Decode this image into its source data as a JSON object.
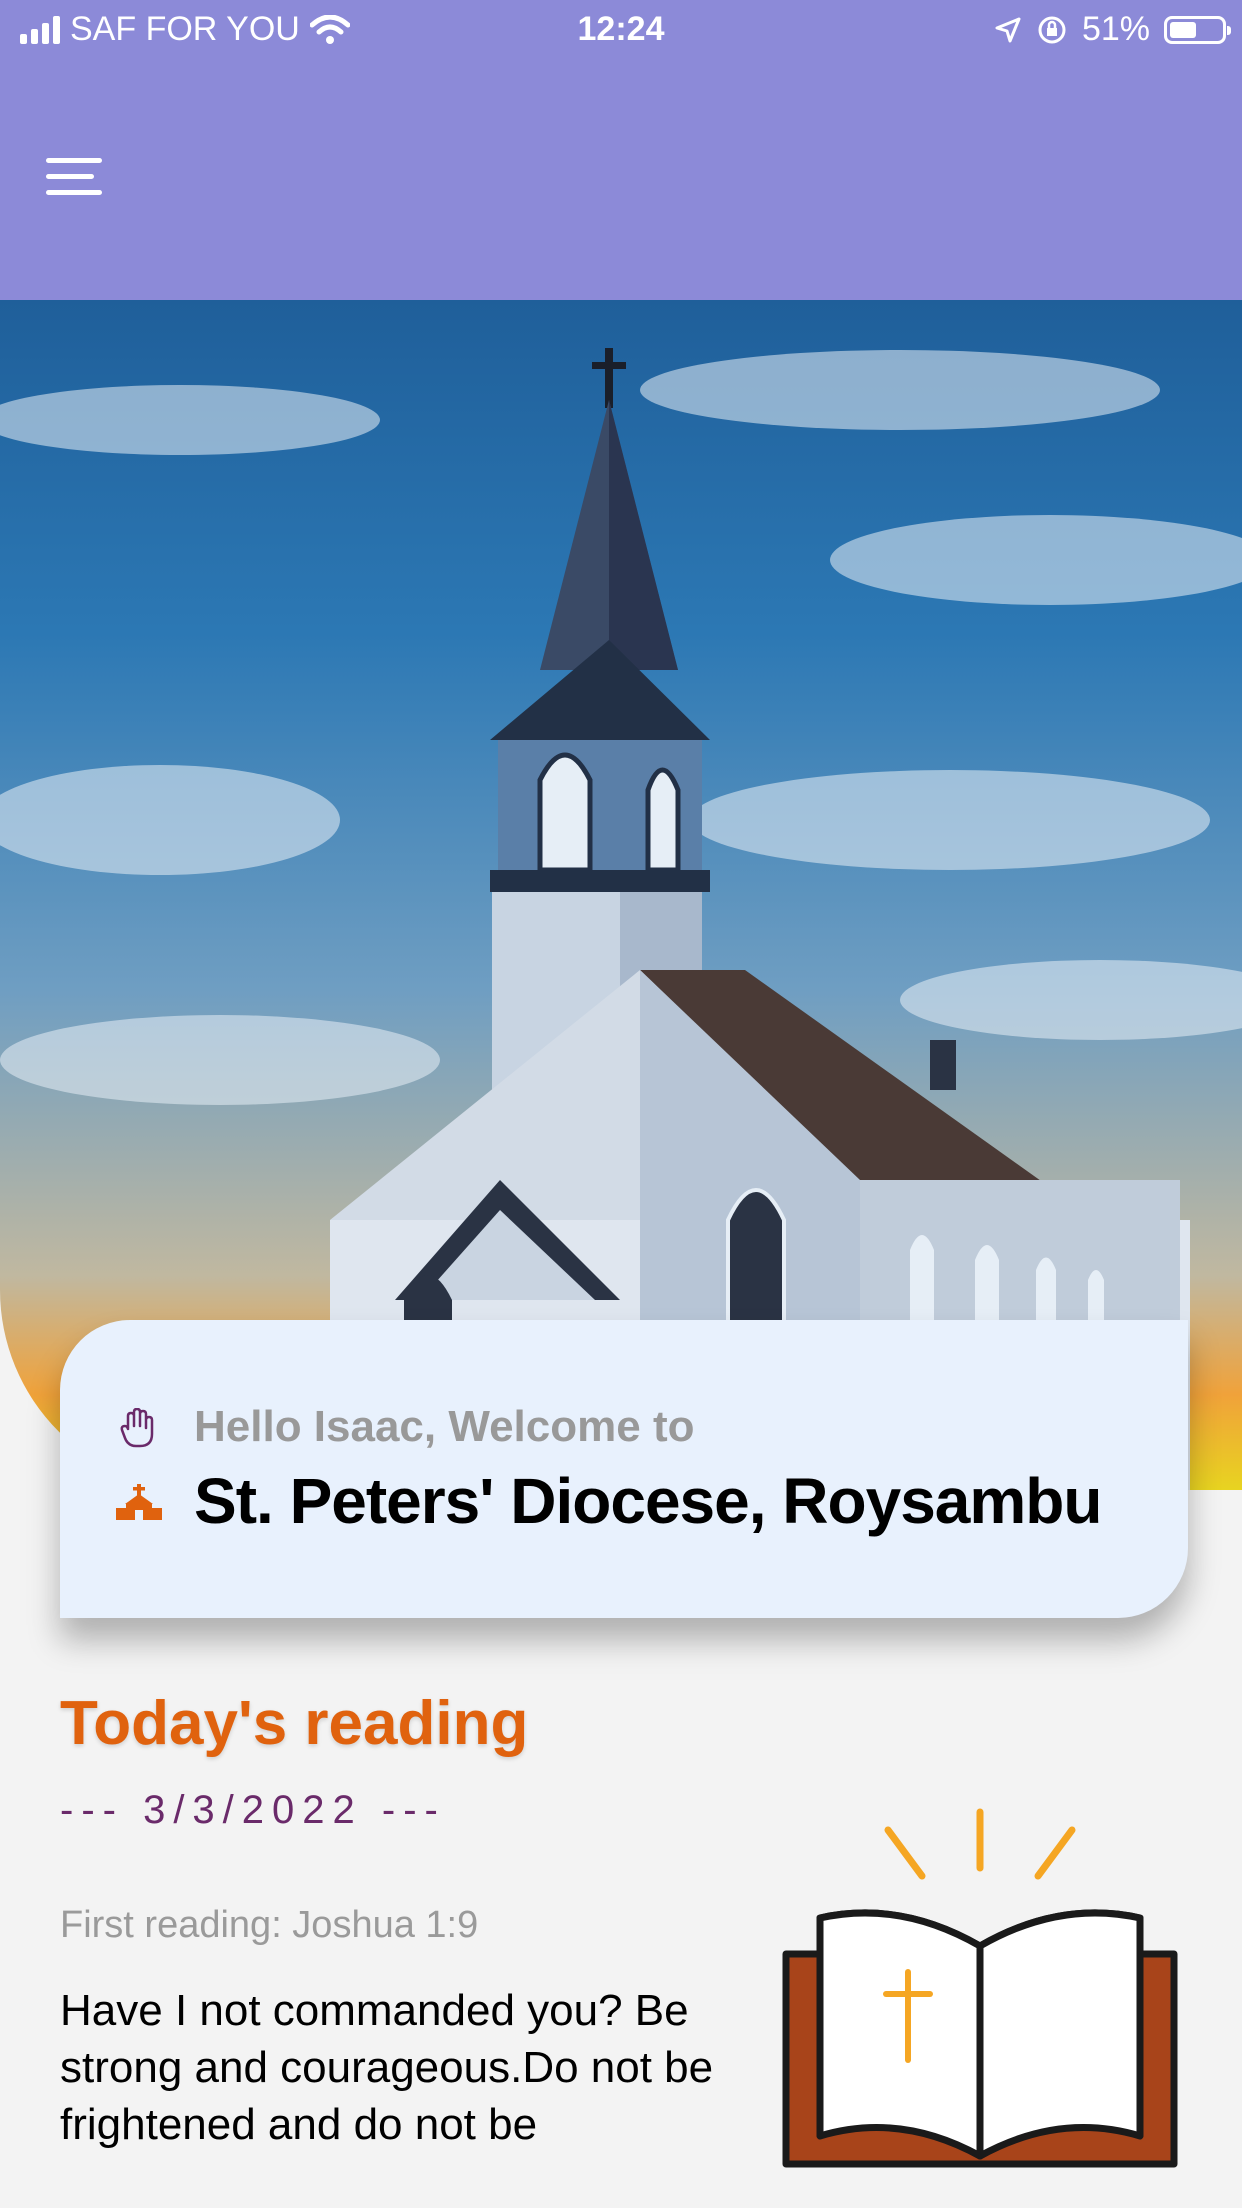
{
  "status_bar": {
    "carrier": "SAF FOR YOU",
    "time": "12:24",
    "battery": "51%",
    "battery_level": 0.51
  },
  "header": {
    "menu_icon": "hamburger-menu-icon"
  },
  "hero": {
    "image": "church-with-steeple-under-sunset-sky"
  },
  "welcome": {
    "greeting": "Hello Isaac, Welcome to",
    "church_name": "St. Peters' Diocese, Roysambu",
    "greeting_icon": "hand-icon",
    "church_icon": "church-icon"
  },
  "reading": {
    "title": "Today's reading",
    "date": "--- 3/3/2022 ---",
    "first_reading_label": "First reading: Joshua 1:9",
    "text": "Have I not commanded you? Be strong and courageous.Do not be frightened and do not be",
    "icon": "open-bible-icon"
  },
  "colors": {
    "header": "#8c8ad8",
    "accent_orange": "#e0620e",
    "date_purple": "#6a2a6a",
    "card_bg": "#e8f1fd",
    "page_bg": "#f3f3f3"
  }
}
